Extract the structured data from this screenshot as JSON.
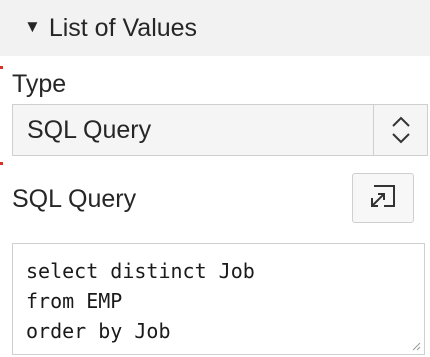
{
  "section": {
    "title": "List of Values",
    "toggle_icon": "triangle-down-icon"
  },
  "type_field": {
    "label": "Type",
    "value": "SQL Query",
    "spinner_icon": "select-updown-chevron-icon"
  },
  "sql_field": {
    "label": "SQL Query",
    "popup_icon": "open-code-editor-icon",
    "lines": [
      "select distinct Job",
      "from EMP",
      "order by Job"
    ]
  },
  "colors": {
    "header_bg": "#f2f2f2",
    "border": "#cfcfcf",
    "required_mark": "#d93025"
  }
}
